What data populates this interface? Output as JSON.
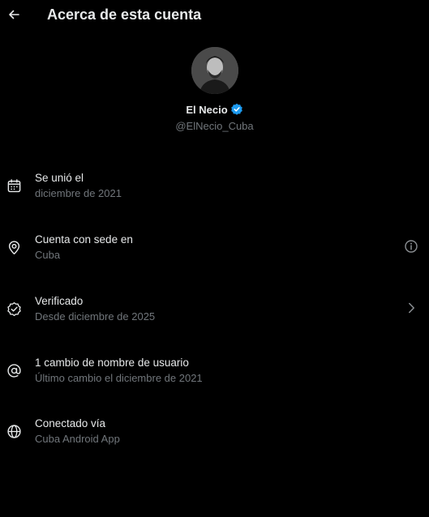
{
  "header": {
    "title": "Acerca de esta cuenta",
    "back_icon": "arrow-left-icon"
  },
  "profile": {
    "name": "El Necio",
    "handle": "@ElNecio_Cuba",
    "verified": true,
    "verified_color": "#1d9bf0"
  },
  "rows": [
    {
      "icon": "calendar-icon",
      "title": "Se unió el",
      "subtitle": "diciembre de 2021"
    },
    {
      "icon": "location-pin-icon",
      "title": "Cuenta con sede en",
      "subtitle": "Cuba",
      "trailing": "info-icon"
    },
    {
      "icon": "verified-check-icon",
      "title": "Verificado",
      "subtitle": "Desde diciembre de 2025",
      "trailing": "chevron-right-icon"
    },
    {
      "icon": "at-sign-icon",
      "title": "1 cambio de nombre de usuario",
      "subtitle": "Último cambio el diciembre de 2021"
    },
    {
      "icon": "globe-icon",
      "title": "Conectado vía",
      "subtitle": "Cuba Android App"
    }
  ],
  "colors": {
    "background": "#000000",
    "text_primary": "#e7e9ea",
    "text_secondary": "#71767b"
  }
}
